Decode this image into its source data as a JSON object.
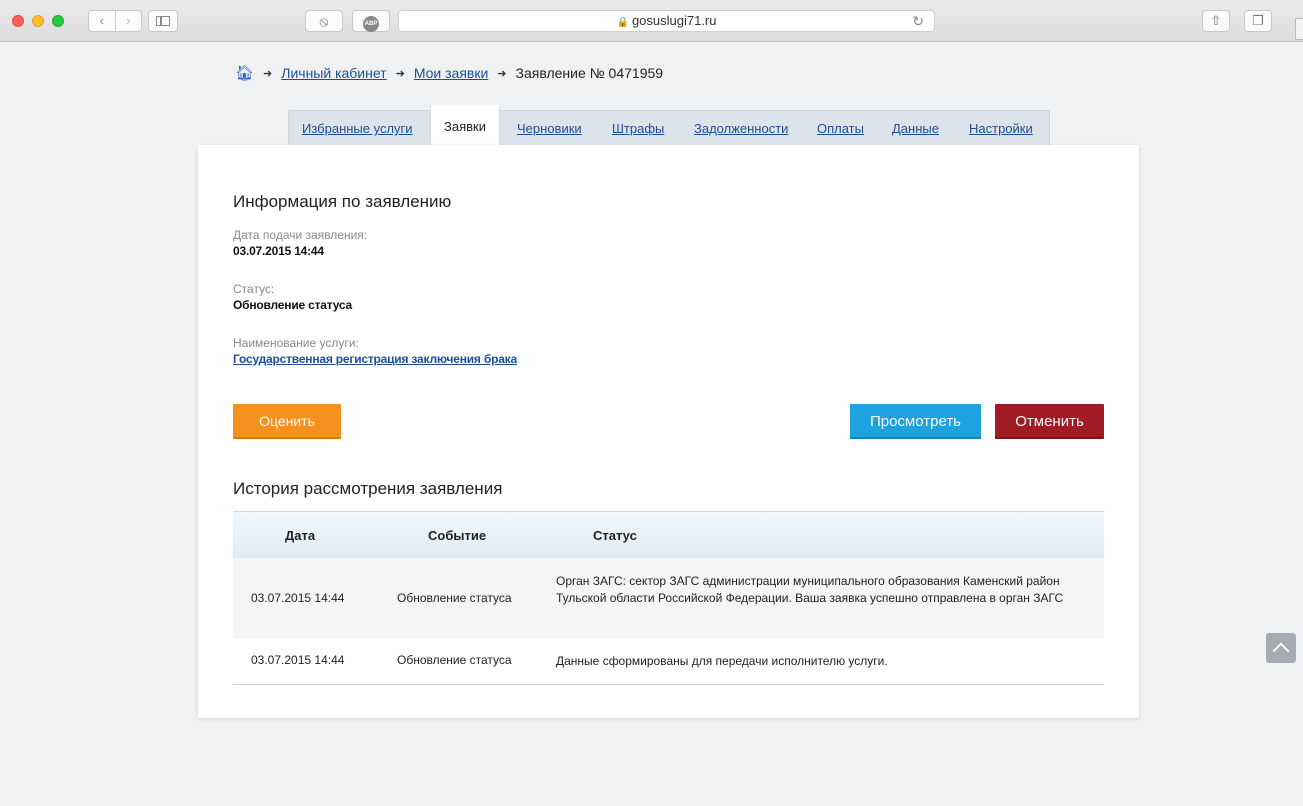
{
  "browser": {
    "url": "gosuslugi71.ru",
    "back_icon": "‹",
    "forward_icon": "›",
    "abp_label": "ABP"
  },
  "breadcrumb": {
    "home_icon": "home-icon",
    "items": [
      "Личный кабинет",
      "Мои заявки"
    ],
    "current": "Заявление № 0471959"
  },
  "tabs": [
    "Избранные услуги",
    "Заявки",
    "Черновики",
    "Штрафы",
    "Задолженности",
    "Оплаты",
    "Данные",
    "Настройки"
  ],
  "active_tab": "Заявки",
  "info": {
    "heading": "Информация по заявлению",
    "date_label": "Дата подачи заявления:",
    "date_value": "03.07.2015 14:44",
    "status_label": "Статус:",
    "status_value": "Обновление статуса",
    "service_label": "Наименование услуги:",
    "service_value": "Государственная регистрация заключения брака"
  },
  "buttons": {
    "rate": "Оценить",
    "view": "Просмотреть",
    "cancel": "Отменить"
  },
  "history": {
    "heading": "История рассмотрения заявления",
    "columns": [
      "Дата",
      "Событие",
      "Статус"
    ],
    "rows": [
      {
        "date": "03.07.2015 14:44",
        "event": "Обновление статуса",
        "status": "Орган ЗАГС: сектор ЗАГС администрации муниципального образования Каменский район Тульской области Российской Федерации. Ваша заявка успешно отправлена в орган ЗАГС"
      },
      {
        "date": "03.07.2015 14:44",
        "event": "Обновление статуса",
        "status": "Данные сформированы для передачи исполнителю услуги."
      }
    ]
  },
  "colors": {
    "link": "#1f4e97",
    "rate_button": "#f5921e",
    "view_button": "#1da1df",
    "cancel_button": "#a11b25"
  }
}
